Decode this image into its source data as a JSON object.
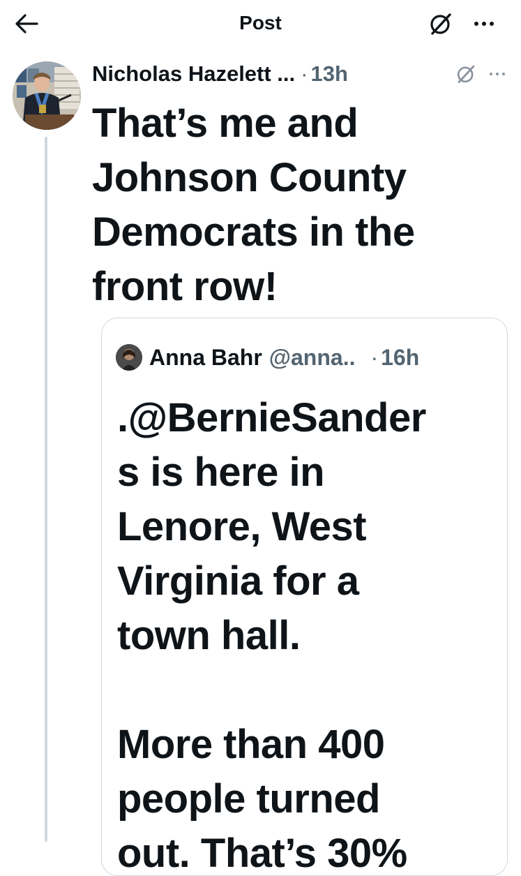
{
  "header": {
    "title": "Post",
    "back_icon": "arrow-left-icon",
    "grok_icon": "grok-icon",
    "more_icon": "more-horizontal-icon"
  },
  "post": {
    "author_name": "Nicholas Hazelett ...",
    "separator": "·",
    "time": "13h",
    "text": "That’s me and\nJohnson County\nDemocrats in the\nfront row!"
  },
  "quote": {
    "author_name": "Anna Bahr",
    "handle": "@anna..",
    "separator": "·",
    "time": "16h",
    "text": ".@BernieSander\ns is here in\nLenore, West\nVirginia for a\ntown hall.\n\nMore than 400\npeople turned\nout. That’s 30%"
  },
  "colors": {
    "text_primary": "#0f1419",
    "text_secondary": "#536471",
    "border": "#cfd9de",
    "background": "#ffffff"
  }
}
